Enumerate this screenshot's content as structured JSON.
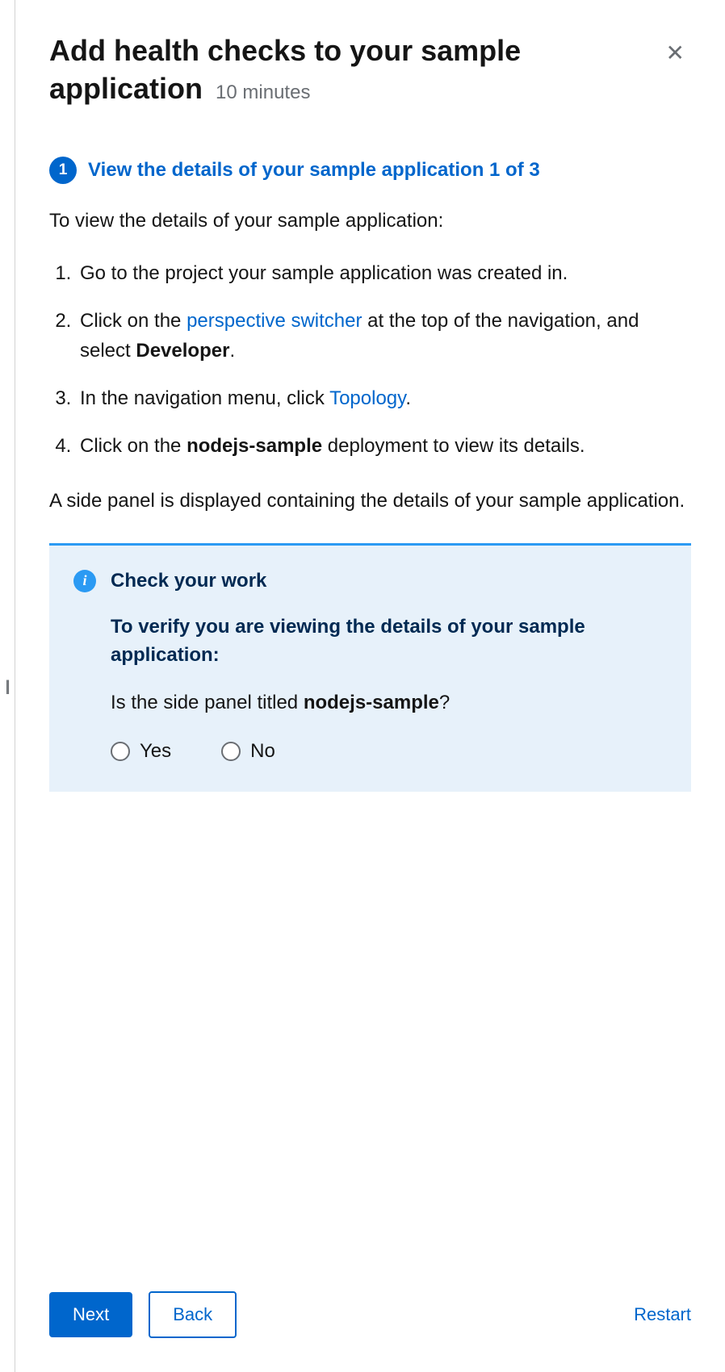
{
  "header": {
    "title": "Add health checks to your sample application",
    "duration": "10 minutes"
  },
  "step": {
    "number": "1",
    "title": "View the details of your sample application",
    "count": "1 of 3"
  },
  "intro": "To view the details of your sample application:",
  "instructions": {
    "i1": "Go to the project your sample application was created in.",
    "i2a": "Click on the ",
    "i2link": "perspective switcher",
    "i2b": " at the top of the navigation, and select ",
    "i2bold": "Developer",
    "i2c": ".",
    "i3a": "In the navigation menu, click ",
    "i3link": "Topology",
    "i3b": ".",
    "i4a": "Click on the ",
    "i4bold": "nodejs-sample",
    "i4b": " deployment to view its details."
  },
  "follow": "A side panel is displayed containing the details of your sample application.",
  "check": {
    "title": "Check your work",
    "desc": "To verify you are viewing the details of your sample application:",
    "q_a": "Is the side panel titled ",
    "q_bold": "nodejs-sample",
    "q_b": "?",
    "yes": "Yes",
    "no": "No"
  },
  "footer": {
    "next": "Next",
    "back": "Back",
    "restart": "Restart"
  }
}
